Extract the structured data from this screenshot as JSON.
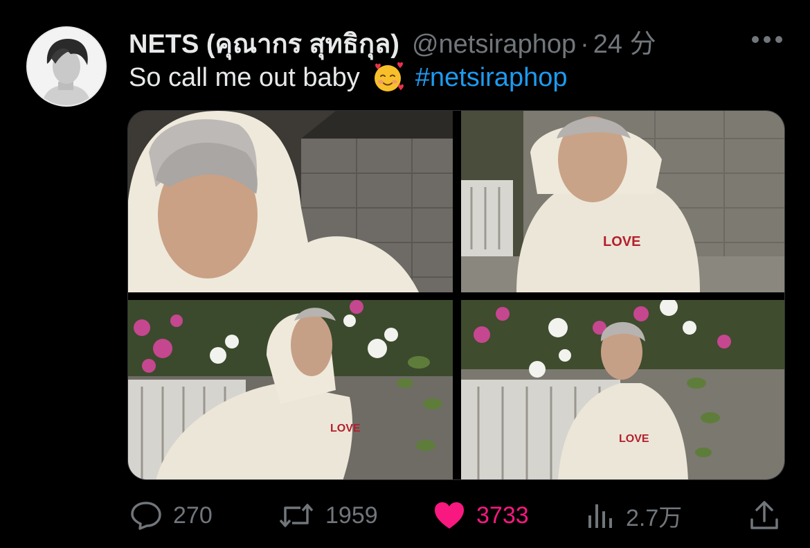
{
  "user": {
    "display_name": "NETS (คุณากร สุทธิกุล)",
    "handle": "@netsiraphop",
    "separator": "·",
    "time": "24 分"
  },
  "tweet": {
    "text": "So call me out baby",
    "emoji": "smiling-face-with-hearts",
    "hashtag": "#netsiraphop"
  },
  "media": {
    "photos": [
      {
        "shirt_text": ""
      },
      {
        "shirt_text": "LOVE"
      },
      {
        "shirt_text": "LOVE"
      },
      {
        "shirt_text": "LOVE"
      }
    ]
  },
  "actions": {
    "reply_count": "270",
    "retweet_count": "1959",
    "like_count": "3733",
    "views_count": "2.7万"
  },
  "colors": {
    "background": "#000000",
    "text": "#e7e9ea",
    "secondary": "#71767b",
    "link": "#1d9bf0",
    "like": "#f91880"
  }
}
